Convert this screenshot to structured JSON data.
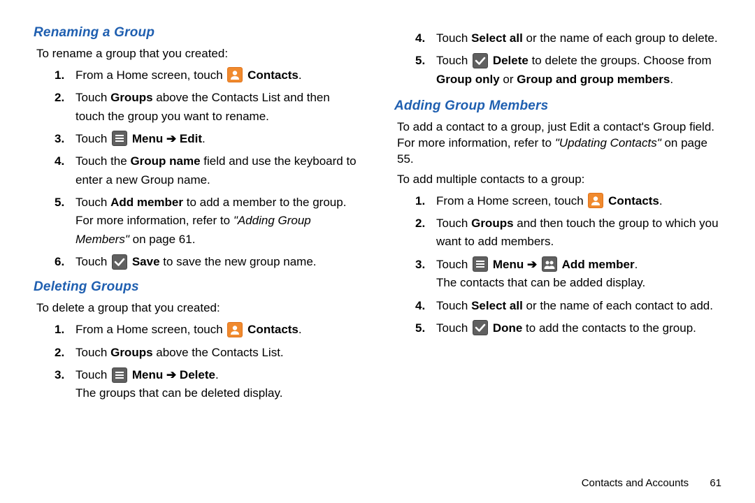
{
  "left": {
    "section1": {
      "heading": "Renaming a Group",
      "intro": "To rename a group that you created:",
      "s1_a": "From a Home screen, touch ",
      "s1_b": "Contacts",
      "s1_c": ".",
      "s2_a": "Touch ",
      "s2_b": "Groups",
      "s2_c": " above the Contacts List and then touch the group you want to rename.",
      "s3_a": "Touch ",
      "s3_b": "Menu",
      "s3_arrow": " ➔ ",
      "s3_c": "Edit",
      "s3_d": ".",
      "s4_a": "Touch the ",
      "s4_b": "Group name",
      "s4_c": " field and use the keyboard to enter a new Group name.",
      "s5_a": "Touch ",
      "s5_b": "Add member",
      "s5_c": " to add a member to the group. For more information, refer to ",
      "s5_d": "\"Adding Group Members\"",
      "s5_e": " on page 61.",
      "s6_a": "Touch ",
      "s6_b": "Save",
      "s6_c": " to save the new group name."
    },
    "section2": {
      "heading": "Deleting Groups",
      "intro": "To delete a group that you created:",
      "s1_a": "From a Home screen, touch ",
      "s1_b": "Contacts",
      "s1_c": ".",
      "s2_a": "Touch ",
      "s2_b": "Groups",
      "s2_c": " above the Contacts List.",
      "s3_a": "Touch ",
      "s3_b": "Menu",
      "s3_arrow": " ➔ ",
      "s3_c": "Delete",
      "s3_d": ".",
      "s3_sub": "The groups that can be deleted display."
    }
  },
  "right": {
    "cont": {
      "s4_a": "Touch ",
      "s4_b": "Select all",
      "s4_c": " or the name of each group to delete.",
      "s5_a": "Touch ",
      "s5_b": "Delete",
      "s5_c": " to delete the groups. Choose from ",
      "s5_d": "Group only",
      "s5_e": " or ",
      "s5_f": "Group and group members",
      "s5_g": "."
    },
    "section3": {
      "heading": "Adding Group Members",
      "intro1": "To add a contact to a group, just Edit a contact's Group field. For more information, refer to ",
      "intro1_ital": "\"Updating Contacts\"",
      "intro1_end": " on page 55.",
      "intro2": "To add multiple contacts to a group:",
      "s1_a": "From a Home screen, touch ",
      "s1_b": "Contacts",
      "s1_c": ".",
      "s2_a": "Touch ",
      "s2_b": "Groups",
      "s2_c": " and then touch the group to which you want to add members.",
      "s3_a": "Touch ",
      "s3_b": "Menu",
      "s3_arrow": " ➔ ",
      "s3_c": "Add member",
      "s3_d": ".",
      "s3_sub": "The contacts that can be added display.",
      "s4_a": "Touch ",
      "s4_b": "Select all",
      "s4_c": " or the name of each contact to add.",
      "s5_a": "Touch ",
      "s5_b": "Done",
      "s5_c": " to add the contacts to the group."
    }
  },
  "footer": {
    "section": "Contacts and Accounts",
    "page": "61"
  }
}
